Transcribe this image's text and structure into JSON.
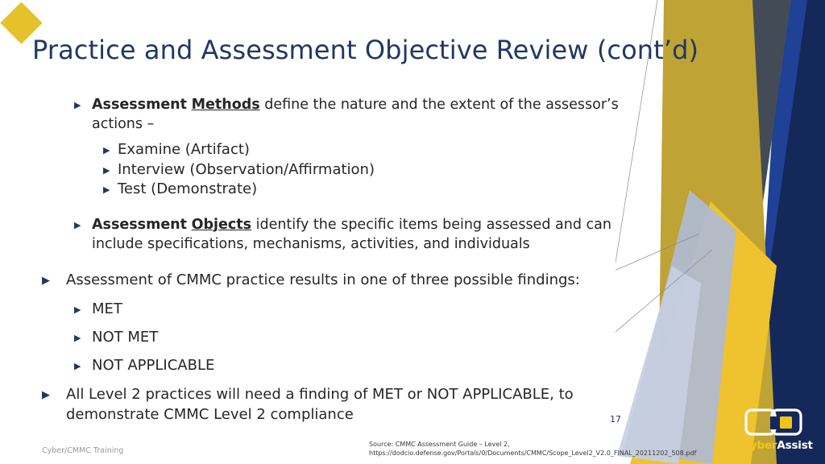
{
  "slide": {
    "title": "Practice and Assessment Objective Review (cont’d)",
    "page_number": "17",
    "footer_left": "Cyber/CMMC Training",
    "source_line_1": "Source: CMMC Assessment Guide – Level 2,",
    "source_line_2": "https://dodcio.defense.gov/Portals/0/Documents/CMMC/Scope_Level2_V2.0_FINAL_20211202_508.pdf"
  },
  "content": {
    "methods": {
      "bold": "Assessment",
      "underline": "Methods",
      "rest": " define the nature and the extent of the assessor’s actions –",
      "sub_items": [
        "Examine (Artifact)",
        "Interview (Observation/Affirmation)",
        "Test (Demonstrate)"
      ]
    },
    "objects": {
      "bold": "Assessment",
      "underline": "Objects",
      "rest": " identify the specific items being assessed and can include specifications, mechanisms, activities, and individuals"
    },
    "findings_intro": "Assessment of CMMC practice results in one of three possible findings:",
    "findings": [
      "MET",
      "NOT MET",
      "NOT APPLICABLE"
    ],
    "closing": "All Level 2 practices will need a finding of MET or NOT APPLICABLE, to demonstrate CMMC Level 2 compliance"
  },
  "logo": {
    "word_1": "Cyber",
    "word_2": "Assist"
  },
  "icons": {
    "bullet_triangle": "▶",
    "title_diamond": "diamond-icon"
  },
  "colors": {
    "title_navy": "#1F3864",
    "diamond_gold": "#E5C12C",
    "body_text": "#262626",
    "deco_gold_dark": "#BFA334",
    "deco_gold_bright": "#EFC32F",
    "deco_blue": "#1F4196",
    "deco_navy": "#14285A",
    "deco_slate": "#434C56",
    "deco_light_blue_gray": "#AFBBD2"
  }
}
